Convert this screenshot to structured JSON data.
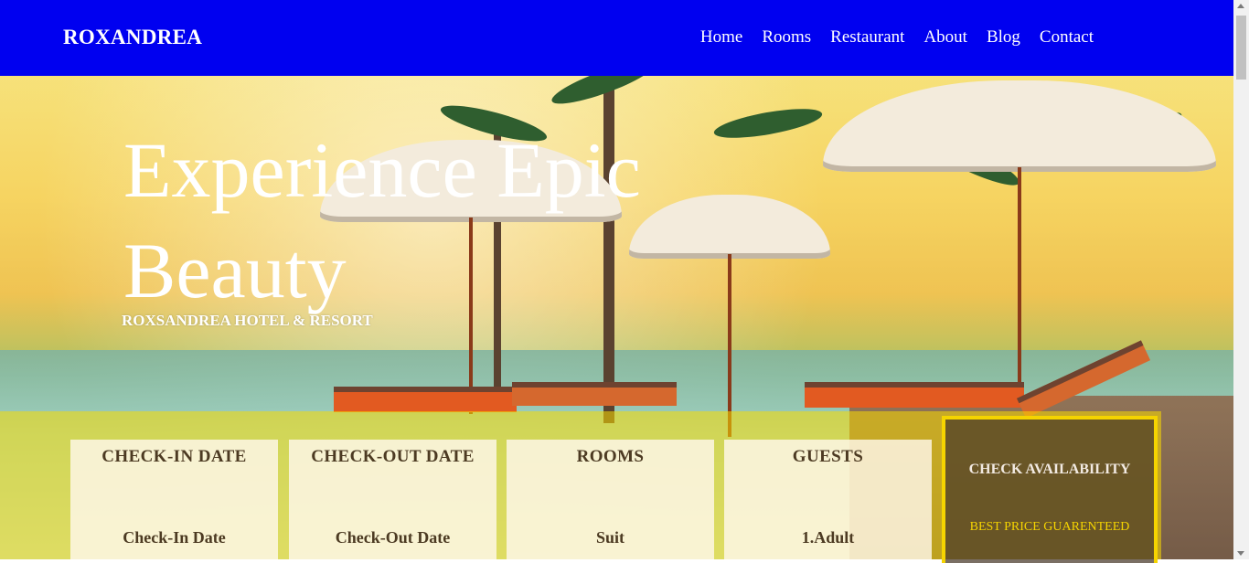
{
  "brand": "ROXANDREA",
  "nav": [
    "Home",
    "Rooms",
    "Restaurant",
    "About",
    "Blog",
    "Contact"
  ],
  "hero": {
    "title_line1": "Experience Epic",
    "title_line2": "Beauty",
    "subtitle": "ROXSANDREA HOTEL & RESORT"
  },
  "booking": {
    "checkin": {
      "label": "CHECK-IN DATE",
      "value": "Check-In Date"
    },
    "checkout": {
      "label": "CHECK-OUT DATE",
      "value": "Check-Out Date"
    },
    "rooms": {
      "label": "ROOMS",
      "value": "Suit"
    },
    "guests": {
      "label": "GUESTS",
      "value": "1.Adult"
    },
    "availability": {
      "label": "CHECK AVAILABILITY",
      "tag": "BEST PRICE GUARENTEED"
    }
  },
  "colors": {
    "nav_bg": "#0000f0",
    "accent_yellow": "#f5d400"
  }
}
